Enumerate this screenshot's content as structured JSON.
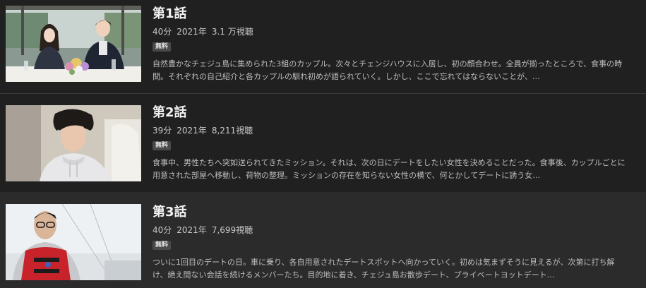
{
  "episodes": [
    {
      "title": "第1話",
      "duration": "40分",
      "year": "2021年",
      "views": "3.1 万視聴",
      "badge": "無料",
      "description": "自然豊かなチェジュ島に集められた3組のカップル。次々とチェンジハウスに入居し、初の顔合わせ。全員が揃ったところで、食事の時間。それぞれの自己紹介と各カップルの馴れ初めが語られていく。しかし、ここで忘れてはならないことが、…"
    },
    {
      "title": "第2話",
      "duration": "39分",
      "year": "2021年",
      "views": "8,211視聴",
      "badge": "無料",
      "description": "食事中、男性たちへ突如送られてきたミッション。それは、次の日にデートをしたい女性を決めることだった。食事後、カップルごとに用意された部屋へ移動し、荷物の整理。ミッションの存在を知らない女性の横で、何とかしてデートに誘う女…"
    },
    {
      "title": "第3話",
      "duration": "40分",
      "year": "2021年",
      "views": "7,699視聴",
      "badge": "無料",
      "description": "ついに1回目のデートの日。車に乗り、各自用意されたデートスポットへ向かっていく。初めは気まずそうに見えるが、次第に打ち解け、絶え間ない会話を続けるメンバーたち。目的地に着き、チェジュ島お散歩デート、プライベートヨットデート…"
    }
  ]
}
